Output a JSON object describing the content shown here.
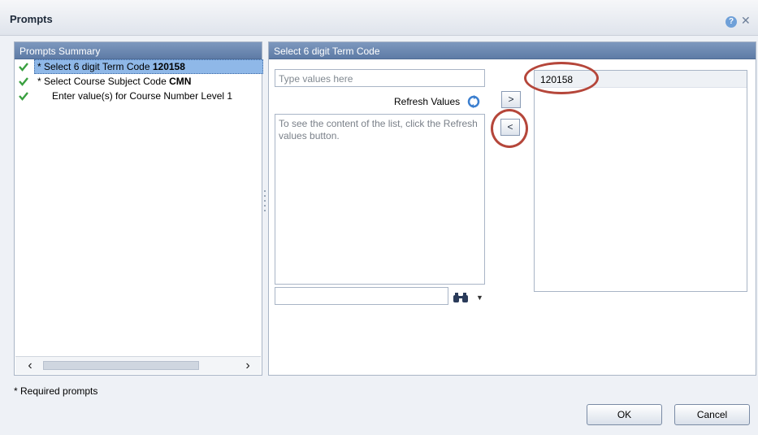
{
  "dialog": {
    "title": "Prompts"
  },
  "summary": {
    "header": "Prompts Summary",
    "items": [
      {
        "prefix": "* Select 6 digit Term Code ",
        "value": "120158",
        "selected": true
      },
      {
        "prefix": "* Select Course Subject Code ",
        "value": "CMN",
        "selected": false
      },
      {
        "prefix": "Enter value(s) for Course Number Level 1",
        "value": "",
        "selected": false
      }
    ],
    "required_note": "* Required prompts"
  },
  "prompt": {
    "header": "Select 6 digit Term Code",
    "input_placeholder": "Type values here",
    "refresh_label": "Refresh Values",
    "list_hint": "To see the content of the list, click the Refresh values button.",
    "add_label": ">",
    "remove_label": "<",
    "selected_values": [
      "120158"
    ]
  },
  "buttons": {
    "ok": "OK",
    "cancel": "Cancel"
  },
  "icons": {
    "check": "check-icon",
    "help": "help-icon",
    "close": "close-icon",
    "refresh": "refresh-icon",
    "search": "binoculars-icon"
  },
  "colors": {
    "header_blue": "#5e7ba6",
    "selected_row": "#8fb8e8",
    "check_green": "#3aa040",
    "annotation_red": "#b5463a"
  }
}
